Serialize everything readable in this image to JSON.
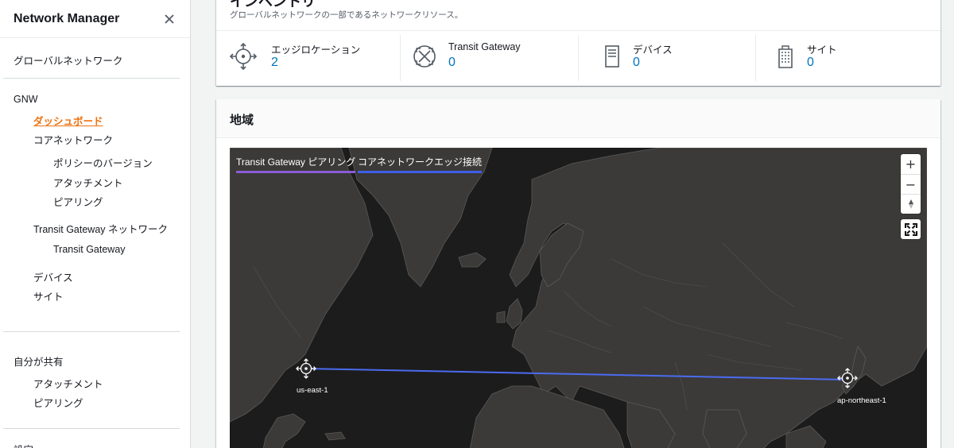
{
  "sidebar": {
    "title": "Network Manager",
    "global_network": "グローバルネットワーク",
    "gnw_section": "GNW",
    "dashboard": "ダッシュボード",
    "core_network": "コアネットワーク",
    "policy_versions": "ポリシーのバージョン",
    "attachments": "アタッチメント",
    "peerings": "ピアリング",
    "tgw_network": "Transit Gateway ネットワーク",
    "transit_gateway": "Transit Gateway",
    "devices": "デバイス",
    "sites": "サイト",
    "shared_section": "自分が共有",
    "shared_attachments": "アタッチメント",
    "shared_peerings": "ピアリング",
    "settings_partial": "設定"
  },
  "inventory": {
    "title": "インベントリ",
    "description": "グローバルネットワークの一部であるネットワークリソース。",
    "metrics": [
      {
        "label": "エッジロケーション",
        "value": "2",
        "icon": "edge-location-icon"
      },
      {
        "label": "Transit Gateway",
        "value": "0",
        "icon": "transit-gateway-icon"
      },
      {
        "label": "デバイス",
        "value": "0",
        "icon": "device-icon"
      },
      {
        "label": "サイト",
        "value": "0",
        "icon": "site-icon"
      }
    ]
  },
  "region": {
    "title": "地域",
    "legend": [
      {
        "label": "Transit Gateway ピアリング",
        "color": "#8a5cd6"
      },
      {
        "label": "コアネットワークエッジ接続",
        "color": "#3f5ee8"
      }
    ],
    "controls": {
      "zoom_in": "+",
      "zoom_out": "−",
      "reset_north": "▲",
      "fullscreen": "fullscreen-icon"
    },
    "nodes": [
      {
        "label": "us-east-1"
      },
      {
        "label": "ap-northeast-1"
      }
    ],
    "colors": {
      "map_bg": "#1c1c1c",
      "land": "#3b3a39",
      "border": "#5a5958",
      "connection": "#4b6bf0"
    }
  }
}
